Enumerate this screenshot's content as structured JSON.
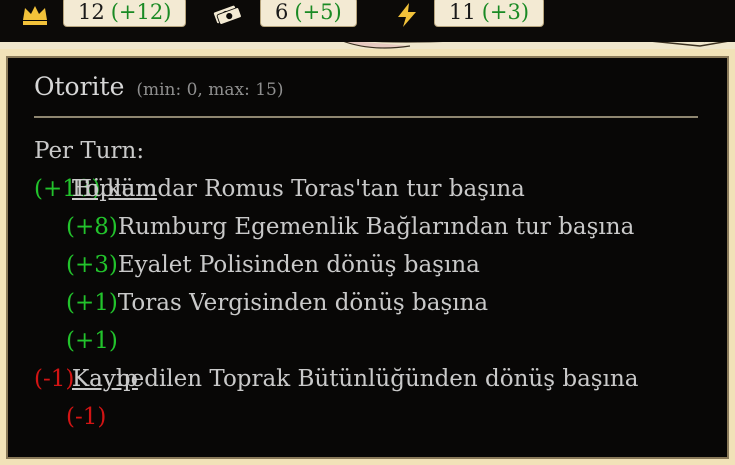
{
  "topbar": {
    "resources": [
      {
        "icon": "crown-icon",
        "value": "12",
        "delta": "(+12)"
      },
      {
        "icon": "money-icon",
        "value": "6",
        "delta": "(+5)"
      },
      {
        "icon": "lightning-icon",
        "value": "11",
        "delta": "(+3)"
      }
    ]
  },
  "tooltip": {
    "title": "Otorite",
    "range": "(min: 0, max: 15)",
    "per_turn_label": "Per Turn:",
    "total_delta": "(+13)",
    "total_label": "Toplam",
    "gain_lines": [
      {
        "delta": "(+1)",
        "text": "Hükümdar Romus Toras'tan tur başına"
      },
      {
        "delta": "(+8)",
        "text": "Rumburg Egemenlik Bağlarından tur başına"
      },
      {
        "delta": "(+3)",
        "text": "Eyalet Polisinden dönüş başına"
      },
      {
        "delta": "(+1)",
        "text": "Toras Vergisinden dönüş başına"
      }
    ],
    "loss_delta": "(-1)",
    "loss_label": "Kayıp",
    "loss_text": "Kaybedilen Toprak Bütünlüğünden dönüş başına",
    "loss_lines": [
      {
        "delta": "(-1)"
      }
    ]
  }
}
